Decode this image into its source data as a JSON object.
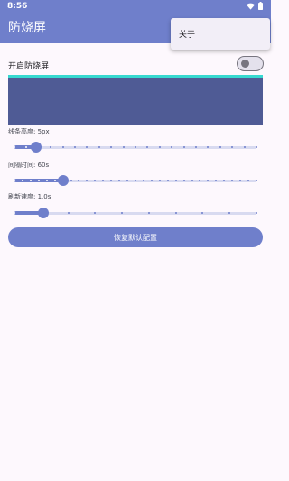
{
  "status_bar": {
    "time": "8:56"
  },
  "app_bar": {
    "title": "防烧屏",
    "color": "#6f7fcb"
  },
  "menu": {
    "items": [
      {
        "label": "关于"
      }
    ]
  },
  "toggle": {
    "label": "开启防烧屏",
    "checked": false
  },
  "preview": {
    "background": "#4f5b95",
    "line_color": "#37d9d0"
  },
  "sliders": [
    {
      "label": "线条高度: 5px",
      "fraction": 0.09,
      "steps": 20
    },
    {
      "label": "间隔时间: 60s",
      "fraction": 0.2,
      "steps": 30
    },
    {
      "label": "刷新速度: 1.0s",
      "fraction": 0.12,
      "steps": 9
    }
  ],
  "reset_button": {
    "label": "恢复默认配置"
  }
}
